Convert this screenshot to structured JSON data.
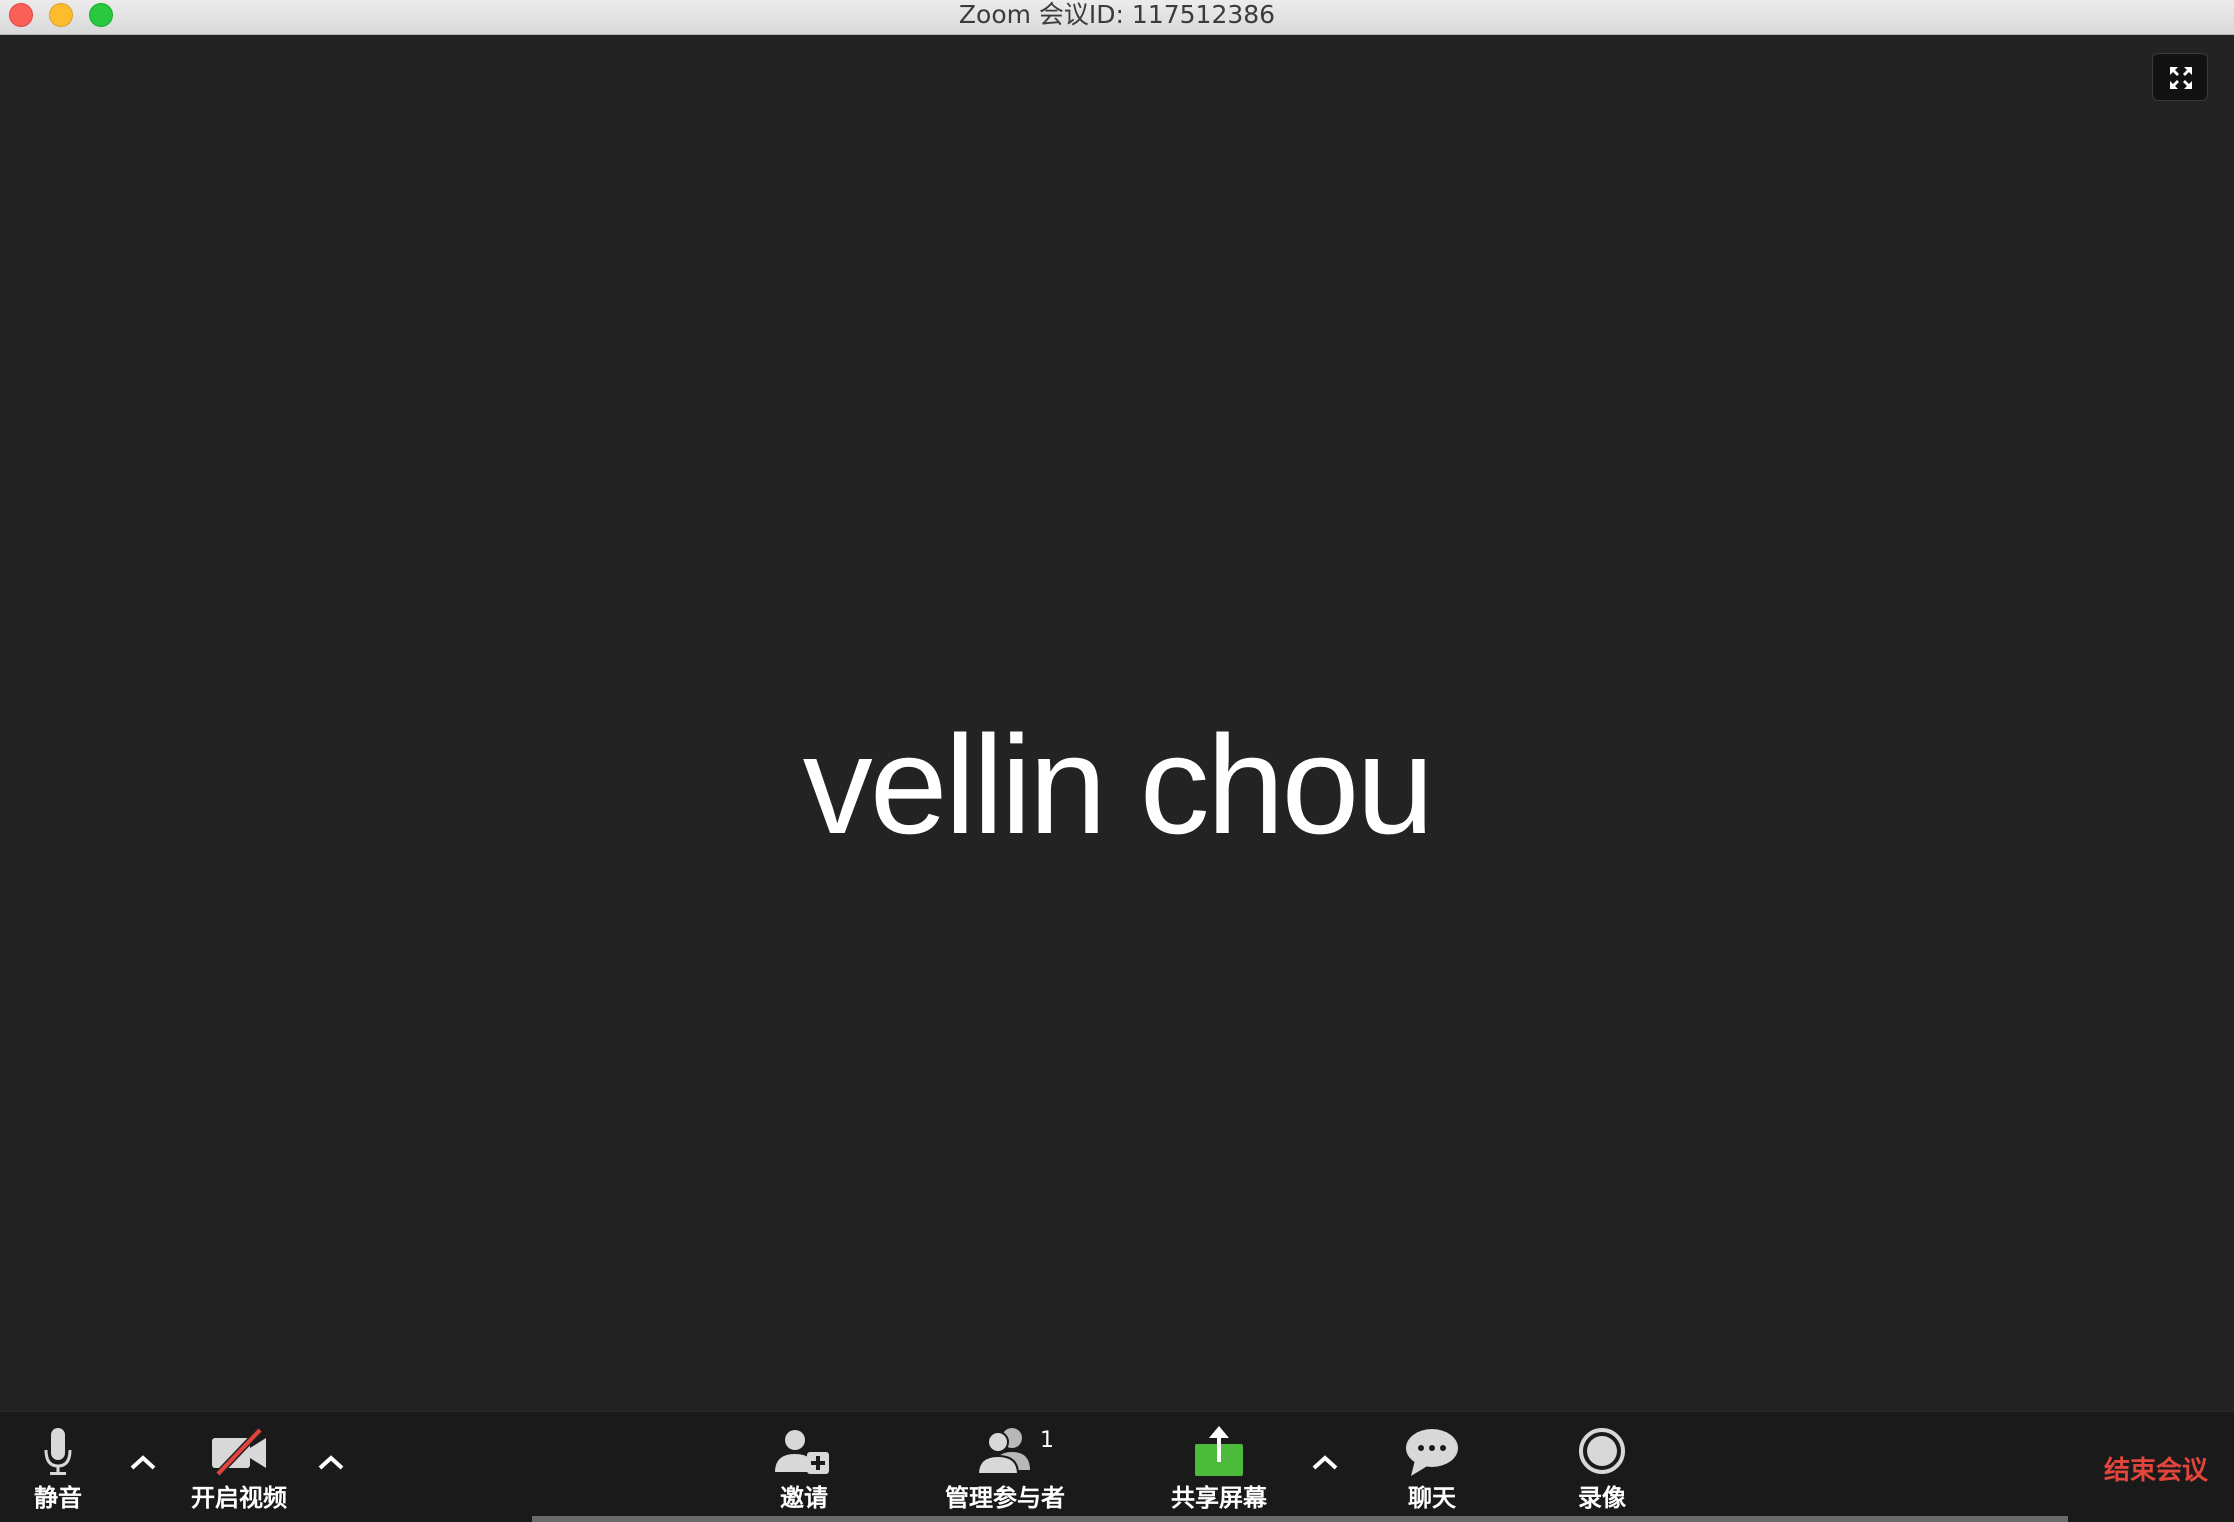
{
  "window": {
    "title": "Zoom 会议ID: 117512386"
  },
  "video": {
    "participant_name": "vellin chou"
  },
  "toolbar": {
    "mute_label": "静音",
    "video_label": "开启视频",
    "invite_label": "邀请",
    "participants_label": "管理参与者",
    "participants_count": "1",
    "share_label": "共享屏幕",
    "chat_label": "聊天",
    "record_label": "录像",
    "end_label": "结束会议"
  },
  "colors": {
    "background": "#232323",
    "share_green": "#4cbb3b",
    "end_red": "#e2453c"
  },
  "icons": {
    "mute": "microphone-icon",
    "video": "video-off-icon",
    "invite": "add-user-icon",
    "participants": "participants-icon",
    "share": "share-screen-icon",
    "chat": "chat-bubble-icon",
    "record": "record-icon",
    "fullscreen": "fullscreen-icon"
  }
}
